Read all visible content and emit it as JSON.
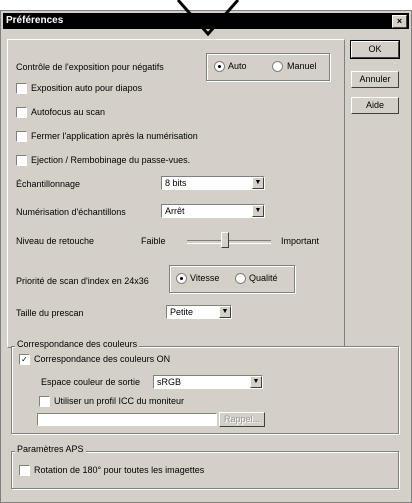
{
  "window": {
    "title": "Préférences",
    "close": "×"
  },
  "buttons": {
    "ok": "OK",
    "cancel": "Annuler",
    "help": "Aide"
  },
  "exposure": {
    "label": "Contrôle de l'exposition pour négatifs",
    "auto": "Auto",
    "manual": "Manuel",
    "selected": "Auto"
  },
  "checkboxes": {
    "auto_slides": {
      "label": "Exposition auto pour diapos",
      "checked": false
    },
    "autofocus": {
      "label": "Autofocus au scan",
      "checked": false
    },
    "close_app": {
      "label": "Fermer l'application après la numérisation",
      "checked": false
    },
    "eject": {
      "label": "Ejection / Rembobinage du passe-vues.",
      "checked": false
    }
  },
  "sampling": {
    "label": "Échantillonnage",
    "value": "8 bits"
  },
  "multi_sample": {
    "label": "Numérisation d'échantillons",
    "value": "Arrêt"
  },
  "retouch": {
    "label": "Niveau de retouche",
    "low": "Faible",
    "high": "Important",
    "level": 0.45
  },
  "index_priority": {
    "label": "Priorité de scan d'index en 24x36",
    "speed": "Vitesse",
    "quality": "Qualité",
    "selected": "Vitesse"
  },
  "prescan": {
    "label": "Taille du prescan",
    "value": "Petite"
  },
  "color_matching": {
    "group_title": "Correspondance des couleurs",
    "on_label": "Correspondance des couleurs ON",
    "on_checked": true,
    "output_space_label": "Espace couleur de sortie",
    "output_space_value": "sRGB",
    "icc_label": "Utiliser un profil ICC du moniteur",
    "icc_checked": false,
    "icc_path": "",
    "recall_button": "Rappel..."
  },
  "aps": {
    "group_title": "Paramètres APS",
    "rotate_label": "Rotation de 180° pour toutes les imagettes",
    "rotate_checked": false
  }
}
